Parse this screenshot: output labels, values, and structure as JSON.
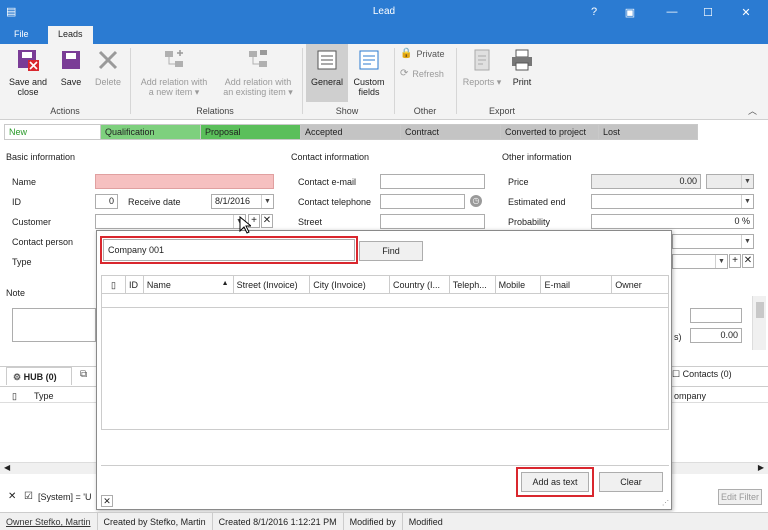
{
  "window": {
    "title": "Lead"
  },
  "tabs": [
    {
      "label": "File"
    },
    {
      "label": "Leads"
    }
  ],
  "ribbon": {
    "actions": {
      "group": "Actions",
      "save_close": "Save and close",
      "save": "Save",
      "delete": "Delete"
    },
    "relations": {
      "group": "Relations",
      "add_new": "Add relation with a new item ▾",
      "add_existing": "Add relation with an existing item ▾"
    },
    "show": {
      "group": "Show",
      "general": "General",
      "custom": "Custom fields"
    },
    "other": {
      "group": "Other",
      "private": "Private",
      "refresh": "Refresh"
    },
    "export": {
      "group": "Export",
      "reports": "Reports ▾",
      "print": "Print"
    }
  },
  "stages": [
    {
      "label": "New",
      "color": "#ffffff"
    },
    {
      "label": "Qualification",
      "color": "#7ed07e"
    },
    {
      "label": "Proposal",
      "color": "#5bbf5b"
    },
    {
      "label": "Accepted",
      "color": "#c4c4c4"
    },
    {
      "label": "Contract",
      "color": "#c4c4c4"
    },
    {
      "label": "Converted to project",
      "color": "#c4c4c4"
    },
    {
      "label": "Lost",
      "color": "#c4c4c4"
    }
  ],
  "basic": {
    "header": "Basic information",
    "name": "Name",
    "id": "ID",
    "id_value": "0",
    "receive_date": "Receive date",
    "receive_value": "8/1/2016",
    "customer": "Customer",
    "contact_person": "Contact person",
    "type": "Type",
    "note": "Note"
  },
  "contact": {
    "header": "Contact information",
    "email": "Contact e-mail",
    "phone": "Contact telephone",
    "street": "Street"
  },
  "other_info": {
    "header": "Other information",
    "price": "Price",
    "price_value": "0.00",
    "estimated_end": "Estimated end",
    "probability": "Probability",
    "probability_value": "0 %",
    "extra_value": "0.00",
    "extra_label": "s)"
  },
  "popup": {
    "search_value": "Company 001",
    "find": "Find",
    "columns": [
      "",
      "ID",
      "Name",
      "Street (Invoice)",
      "City (Invoice)",
      "Country (I...",
      "Teleph...",
      "Mobile",
      "E-mail",
      "Owner"
    ],
    "add_as_text": "Add as text",
    "clear": "Clear"
  },
  "lower": {
    "hub_tab": "HUB (0)",
    "contacts_tab": "Contacts (0)",
    "type_col": "Type",
    "company_col": "ompany",
    "filter_text": "[System] = 'U",
    "edit_filter": "Edit Filter"
  },
  "status": [
    "Owner Stefko, Martin",
    "Created by Stefko, Martin",
    "Created 8/1/2016 1:12:21 PM",
    "Modified by",
    "Modified"
  ]
}
